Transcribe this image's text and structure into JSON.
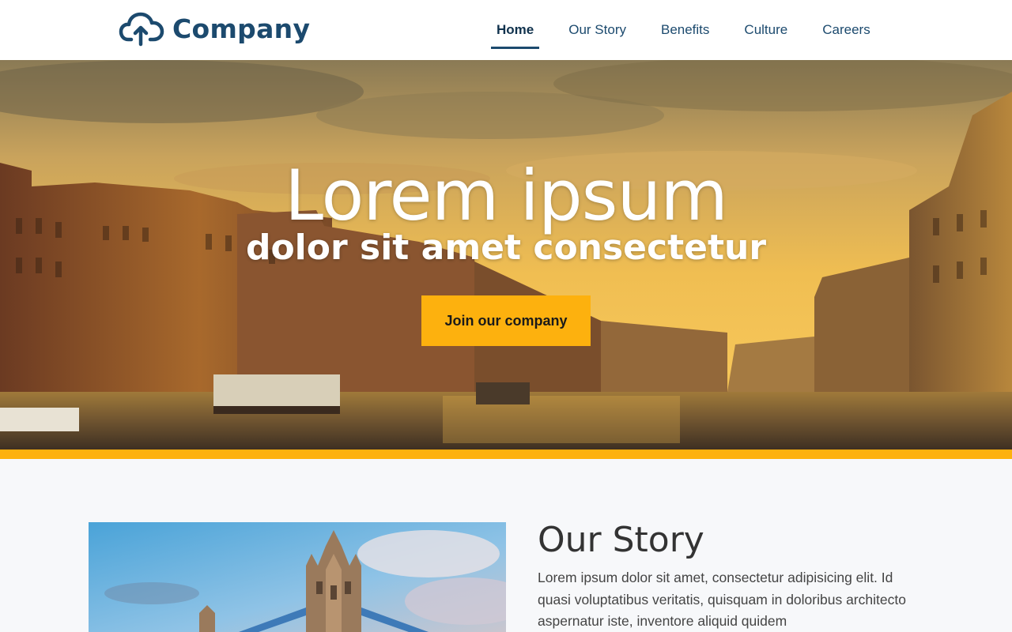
{
  "header": {
    "logo_text": "Company",
    "logo_icon": "cloud-upload-icon",
    "brand_color": "#1c4a6e"
  },
  "nav": {
    "items": [
      {
        "label": "Home",
        "active": true
      },
      {
        "label": "Our Story",
        "active": false
      },
      {
        "label": "Benefits",
        "active": false
      },
      {
        "label": "Culture",
        "active": false
      },
      {
        "label": "Careers",
        "active": false
      }
    ]
  },
  "hero": {
    "title": "Lorem ipsum",
    "subtitle": "dolor sit amet consectetur",
    "cta_label": "Join our company",
    "accent_color": "#fdb10e"
  },
  "story": {
    "title": "Our Story",
    "text": "Lorem ipsum dolor sit amet, consectetur adipisicing elit. Id quasi voluptatibus veritatis, quisquam in doloribus architecto aspernatur iste, inventore aliquid quidem"
  }
}
